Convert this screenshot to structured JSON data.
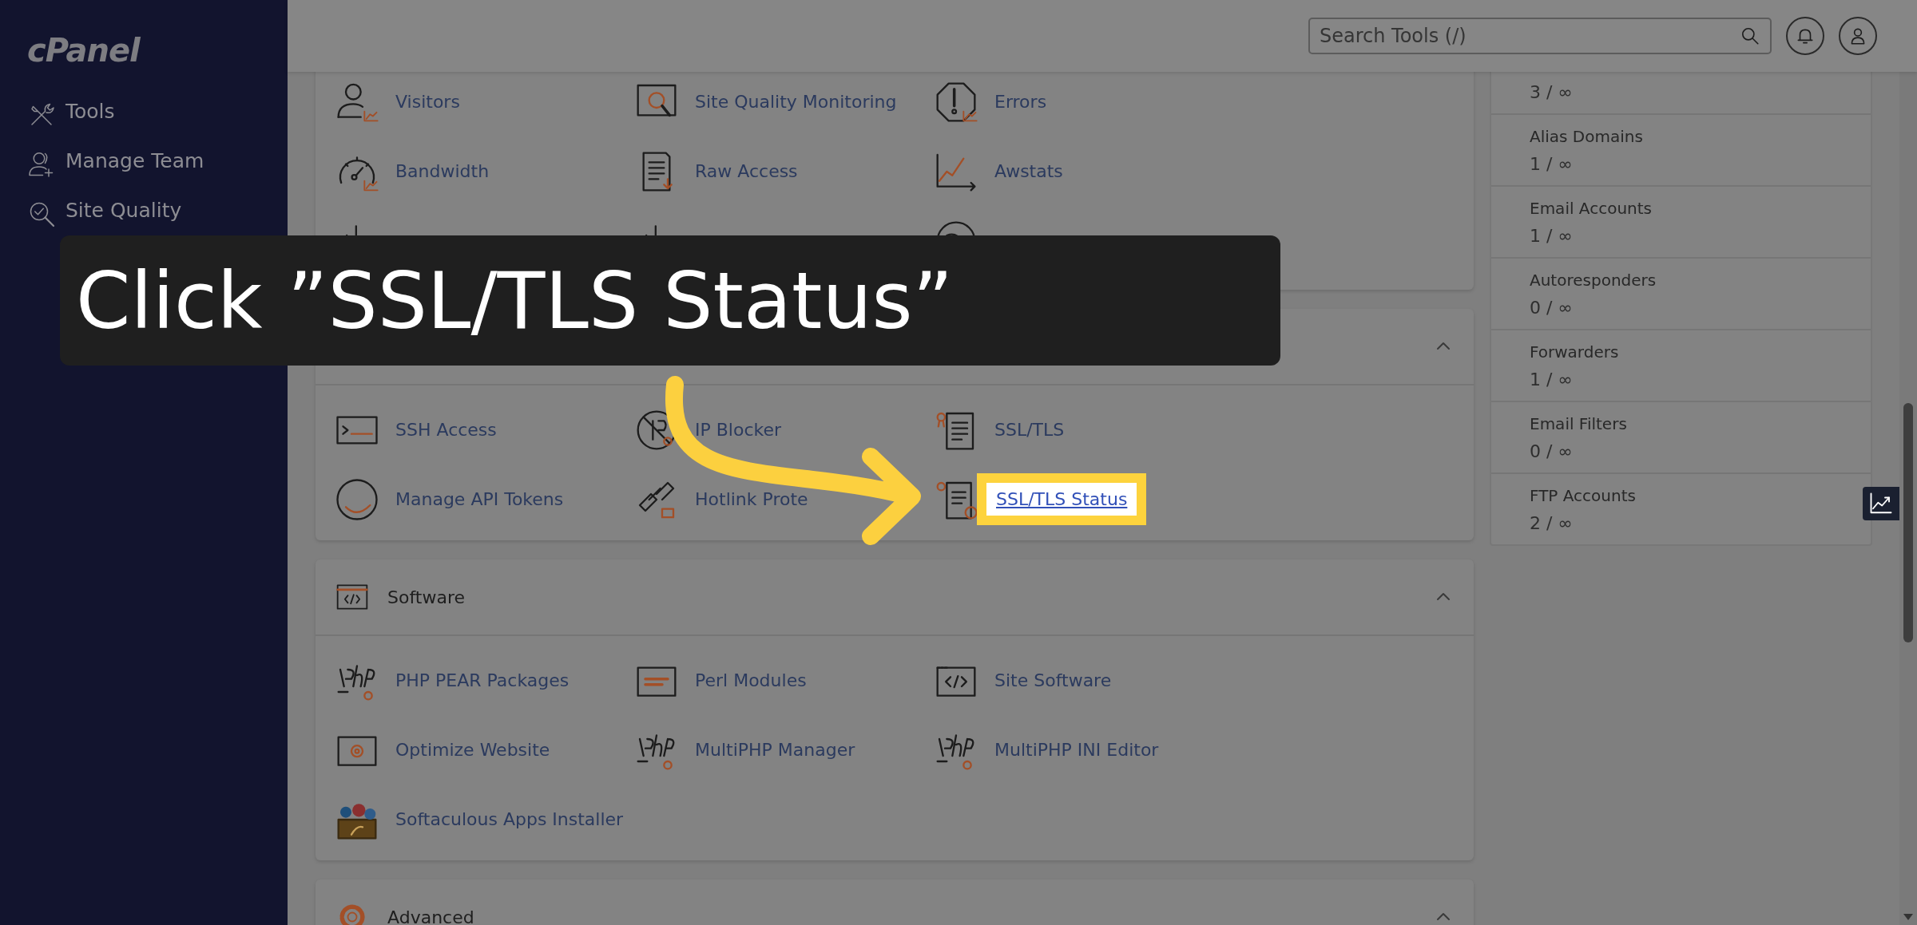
{
  "sidebar": {
    "logo": "cPanel",
    "items": [
      {
        "label": "Tools"
      },
      {
        "label": "Manage Team"
      },
      {
        "label": "Site Quality"
      }
    ]
  },
  "topbar": {
    "search": {
      "placeholder": "Search Tools (/)"
    }
  },
  "sections": [
    {
      "items": [
        {
          "label": "Visitors",
          "highlighted": false
        },
        {
          "label": "Site Quality Monitoring",
          "highlighted": false
        },
        {
          "label": "Errors",
          "highlighted": false
        },
        {
          "label": "Bandwidth",
          "highlighted": false
        },
        {
          "label": "Raw Access",
          "highlighted": false
        },
        {
          "label": "Awstats",
          "highlighted": false
        }
      ]
    },
    {
      "expanded": true,
      "items": [
        {
          "label": "SSH Access",
          "highlighted": false
        },
        {
          "label": "IP Blocker",
          "highlighted": false
        },
        {
          "label": "SSL/TLS",
          "highlighted": false
        },
        {
          "label": "Manage API Tokens",
          "highlighted": false
        },
        {
          "label": "Hotlink Prote",
          "highlighted": false
        },
        {
          "label": "SSL/TLS Status",
          "highlighted": true
        }
      ]
    },
    {
      "title": "Software",
      "expanded": true,
      "items": [
        {
          "label": "PHP PEAR Packages",
          "highlighted": false
        },
        {
          "label": "Perl Modules",
          "highlighted": false
        },
        {
          "label": "Site Software",
          "highlighted": false
        },
        {
          "label": "Optimize Website",
          "highlighted": false
        },
        {
          "label": "MultiPHP Manager",
          "highlighted": false
        },
        {
          "label": "MultiPHP INI Editor",
          "highlighted": false
        },
        {
          "label": "Softaculous Apps Installer",
          "highlighted": false
        }
      ]
    },
    {
      "title": "Advanced",
      "expanded": true
    }
  ],
  "stats": [
    {
      "value": "3 / ∞"
    },
    {
      "label": "Alias Domains",
      "value": "1 / ∞"
    },
    {
      "label": "Email Accounts",
      "value": "1 / ∞"
    },
    {
      "label": "Autoresponders",
      "value": "0 / ∞"
    },
    {
      "label": "Forwarders",
      "value": "1 / ∞"
    },
    {
      "label": "Email Filters",
      "value": "0 / ∞"
    },
    {
      "label": "FTP Accounts",
      "value": "2 / ∞"
    }
  ],
  "tutorial": {
    "caption": "Click ”SSL/TLS Status”"
  }
}
